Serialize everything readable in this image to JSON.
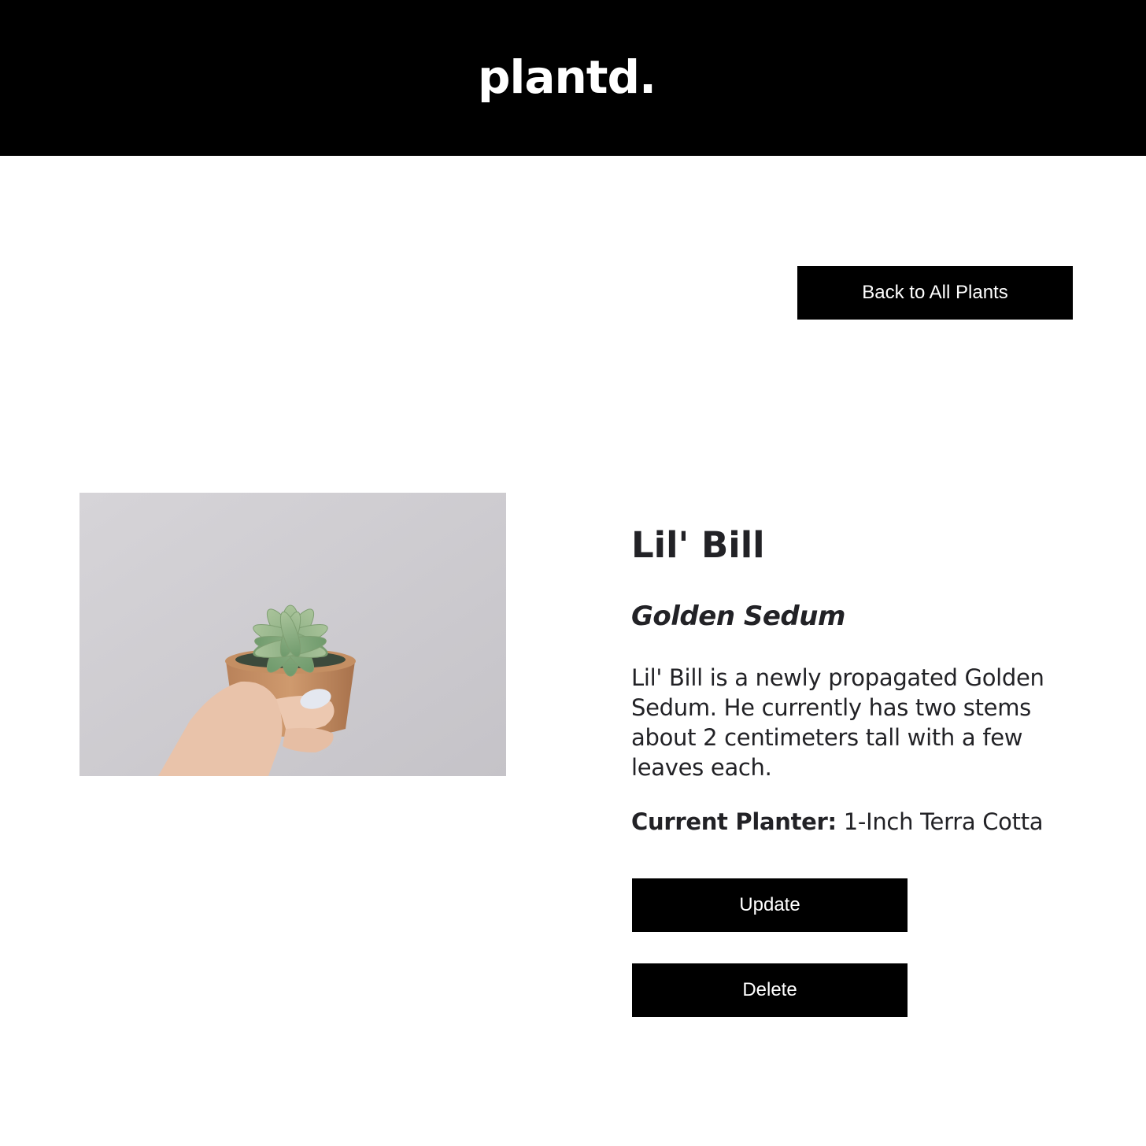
{
  "header": {
    "logo": "plantd."
  },
  "nav": {
    "back_label": "Back to All Plants"
  },
  "plant": {
    "name": "Lil' Bill",
    "species": "Golden Sedum",
    "description": "Lil' Bill is a newly propagated Golden Sedum. He currently has two stems about 2 centimeters tall with a few leaves each.",
    "planter_label": "Current Planter:",
    "planter_value": "1-Inch Terra Cotta"
  },
  "actions": {
    "update_label": "Update",
    "delete_label": "Delete"
  },
  "colors": {
    "header_bg": "#000000",
    "button_bg": "#000000",
    "button_text": "#ffffff",
    "body_text": "#222226"
  }
}
